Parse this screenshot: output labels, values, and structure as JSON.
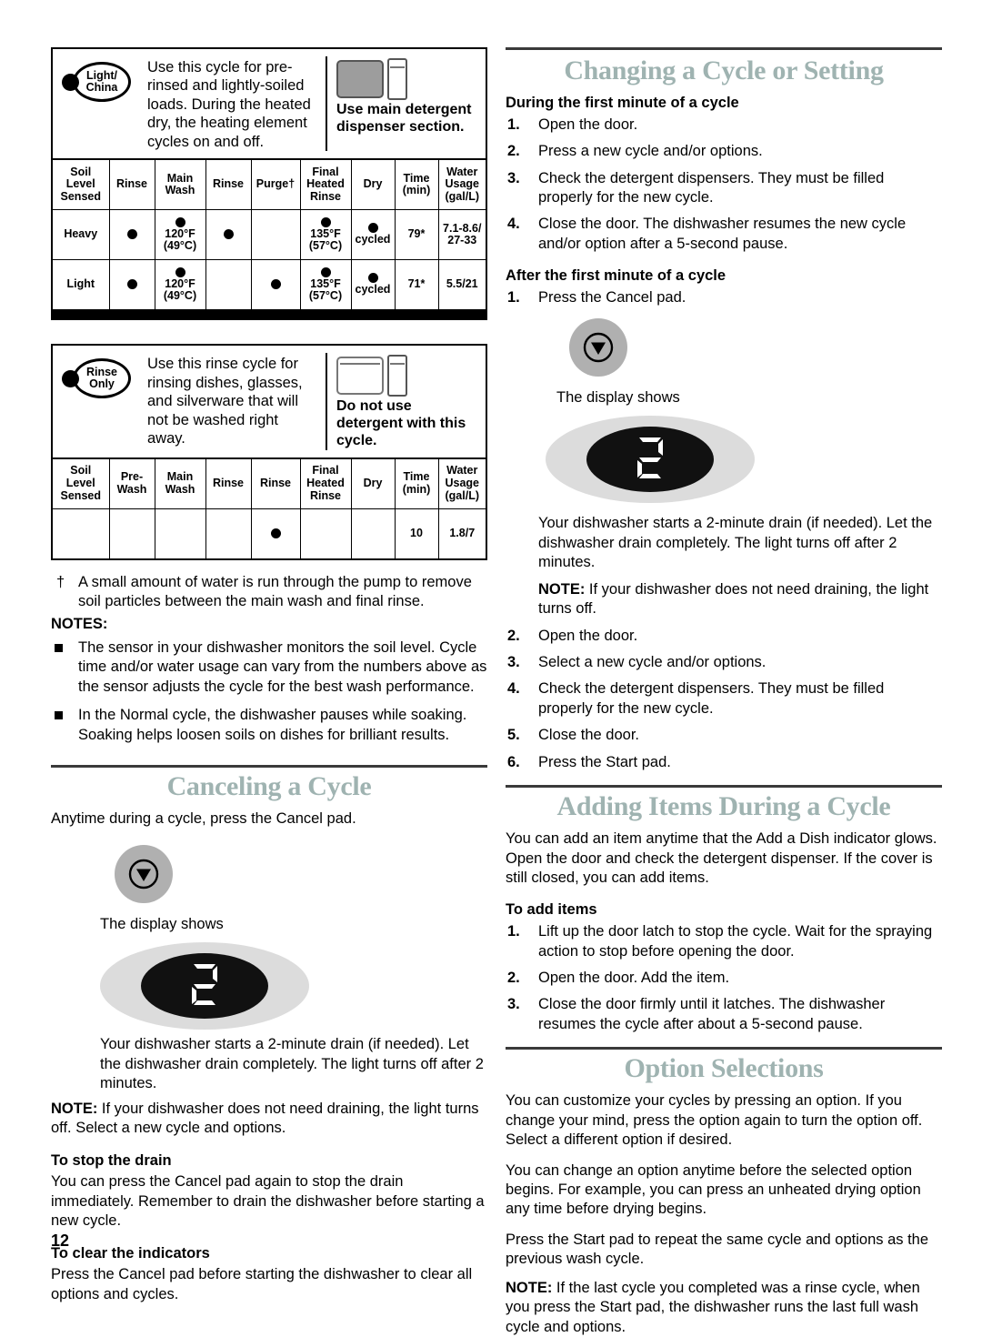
{
  "page": {
    "number": "12"
  },
  "left_column": {
    "cycle_light_china": {
      "pad_label_line1": "Light/",
      "pad_label_line2": "China",
      "description": "Use this cycle for pre-rinsed and lightly-soiled loads. During the heated dry, the heating element cycles on and off.",
      "dispenser_note": "Use main detergent dispenser section.",
      "dispenser_icon": "detergent-dispenser-main-filled",
      "table": {
        "headers": [
          "Soil Level Sensed",
          "Rinse",
          "Main Wash",
          "Rinse",
          "Purge†",
          "Final Heated Rinse",
          "Dry",
          "Time (min)",
          "Water Usage (gal/L)"
        ],
        "rows": [
          {
            "soil_level": "Heavy",
            "rinse1": {
              "dot": true,
              "text": ""
            },
            "main_wash": {
              "dot": true,
              "text": "120°F (49°C)"
            },
            "rinse2": {
              "dot": true,
              "text": ""
            },
            "purge": {
              "dot": false,
              "text": ""
            },
            "final_heated_rinse": {
              "dot": true,
              "text": "135°F (57°C)"
            },
            "dry": {
              "dot": true,
              "text": "cycled"
            },
            "time": "79*",
            "water_usage": "7.1-8.6/ 27-33"
          },
          {
            "soil_level": "Light",
            "rinse1": {
              "dot": true,
              "text": ""
            },
            "main_wash": {
              "dot": true,
              "text": "120°F (49°C)"
            },
            "rinse2": {
              "dot": false,
              "text": ""
            },
            "purge": {
              "dot": true,
              "text": ""
            },
            "final_heated_rinse": {
              "dot": true,
              "text": "135°F (57°C)"
            },
            "dry": {
              "dot": true,
              "text": "cycled"
            },
            "time": "71*",
            "water_usage": "5.5/21"
          }
        ]
      }
    },
    "cycle_rinse_only": {
      "pad_label_line1": "Rinse",
      "pad_label_line2": "Only",
      "description": "Use this rinse cycle for rinsing dishes, glasses, and silverware that will not be washed right away.",
      "dispenser_note": "Do not use detergent with this cycle.",
      "dispenser_icon": "detergent-dispenser-empty",
      "table": {
        "headers": [
          "Soil Level Sensed",
          "Pre-Wash",
          "Main Wash",
          "Rinse",
          "Rinse",
          "Final Heated Rinse",
          "Dry",
          "Time (min)",
          "Water Usage (gal/L)"
        ],
        "rows": [
          {
            "soil_level": "",
            "pre_wash": {
              "dot": false,
              "text": ""
            },
            "main_wash": {
              "dot": false,
              "text": ""
            },
            "rinse1": {
              "dot": false,
              "text": ""
            },
            "rinse2": {
              "dot": true,
              "text": ""
            },
            "final_heated_rinse": {
              "dot": false,
              "text": ""
            },
            "dry": {
              "dot": false,
              "text": ""
            },
            "time": "10",
            "water_usage": "1.8/7"
          }
        ]
      }
    },
    "dagger_note": "A small amount of water is run through the pump to remove soil particles between the main wash and final rinse.",
    "notes_label": "NOTES:",
    "notes": [
      "The sensor in your dishwasher monitors the soil level. Cycle time and/or water usage can vary from the numbers above as the sensor adjusts the cycle for the best wash performance.",
      "In the Normal cycle, the dishwasher pauses while soaking. Soaking helps loosen soils on dishes for brilliant results."
    ],
    "canceling": {
      "title": "Canceling a Cycle",
      "intro": "Anytime during a cycle, press the Cancel pad.",
      "cancel_pad_icon": "cancel-pad-icon",
      "display_caption": "The display shows",
      "display_value": "2",
      "body": "Your dishwasher starts a 2-minute drain (if needed). Let the dishwasher drain completely. The light turns off after 2 minutes.",
      "note_label": "NOTE:",
      "note_text": " If your dishwasher does not need draining, the light turns off. Select a new cycle and options.",
      "stop_drain_title": "To stop the drain",
      "stop_drain_body": "You can press the Cancel pad again to stop the drain immediately. Remember to drain the dishwasher before starting a new cycle.",
      "clear_indicators_title": "To clear the indicators",
      "clear_indicators_body": "Press the Cancel pad before starting the dishwasher to clear all options and cycles."
    }
  },
  "right_column": {
    "changing": {
      "title": "Changing a Cycle or Setting",
      "first_minute_title": "During the first minute of a cycle",
      "first_minute_steps": [
        "Open the door.",
        "Press a new cycle and/or options.",
        "Check the detergent dispensers. They must be filled properly for the new cycle.",
        "Close the door. The dishwasher resumes the new cycle and/or option after a 5-second pause."
      ],
      "after_minute_title": "After the first minute of a cycle",
      "after_step_1": "Press the Cancel pad.",
      "cancel_pad_icon": "cancel-pad-icon",
      "display_caption": "The display shows",
      "display_value": "2",
      "sub_body": "Your dishwasher starts a 2-minute drain (if needed). Let the dishwasher drain completely. The light turns off after 2 minutes.",
      "sub_note_label": "NOTE:",
      "sub_note_text": " If your dishwasher does not need draining, the light turns off.",
      "after_minute_steps_rest": [
        {
          "num": "2.",
          "text": "Open the door."
        },
        {
          "num": "3.",
          "text": "Select a new cycle and/or options."
        },
        {
          "num": "4.",
          "text": "Check the detergent dispensers. They must be filled properly for the new cycle."
        },
        {
          "num": "5.",
          "text": "Close the door."
        },
        {
          "num": "6.",
          "text": "Press the Start pad."
        }
      ]
    },
    "adding_items": {
      "title": "Adding Items During a Cycle",
      "intro": "You can add an item anytime that the Add a Dish indicator glows. Open the door and check the detergent dispenser. If the cover is still closed, you can add items.",
      "to_add_title": "To add items",
      "steps": [
        "Lift up the door latch to stop the cycle. Wait for the spraying action to stop before opening the door.",
        "Open the door. Add the item.",
        "Close the door firmly until it latches. The dishwasher resumes the cycle after about a 5-second pause."
      ]
    },
    "option_selections": {
      "title": "Option Selections",
      "para1": "You can customize your cycles by pressing an option. If you change your mind, press the option again to turn the option off. Select a different option if desired.",
      "para2": "You can change an option anytime before the selected option begins. For example, you can press an unheated drying option any time before drying begins.",
      "para3": "Press the Start pad to repeat the same cycle and options as the previous wash cycle.",
      "note_label": "NOTE:",
      "note_text": " If the last cycle you completed was a rinse cycle, when you press the Start pad, the dishwasher runs the last full wash cycle and options."
    }
  },
  "colors": {
    "heading": "#9fb3b1",
    "rule": "#3a3a3a",
    "pad_gray": "#b0b0b0",
    "display_halo": "#dcdcdc",
    "display_lens": "#111111",
    "dispenser_fill": "#9d9d9d"
  }
}
